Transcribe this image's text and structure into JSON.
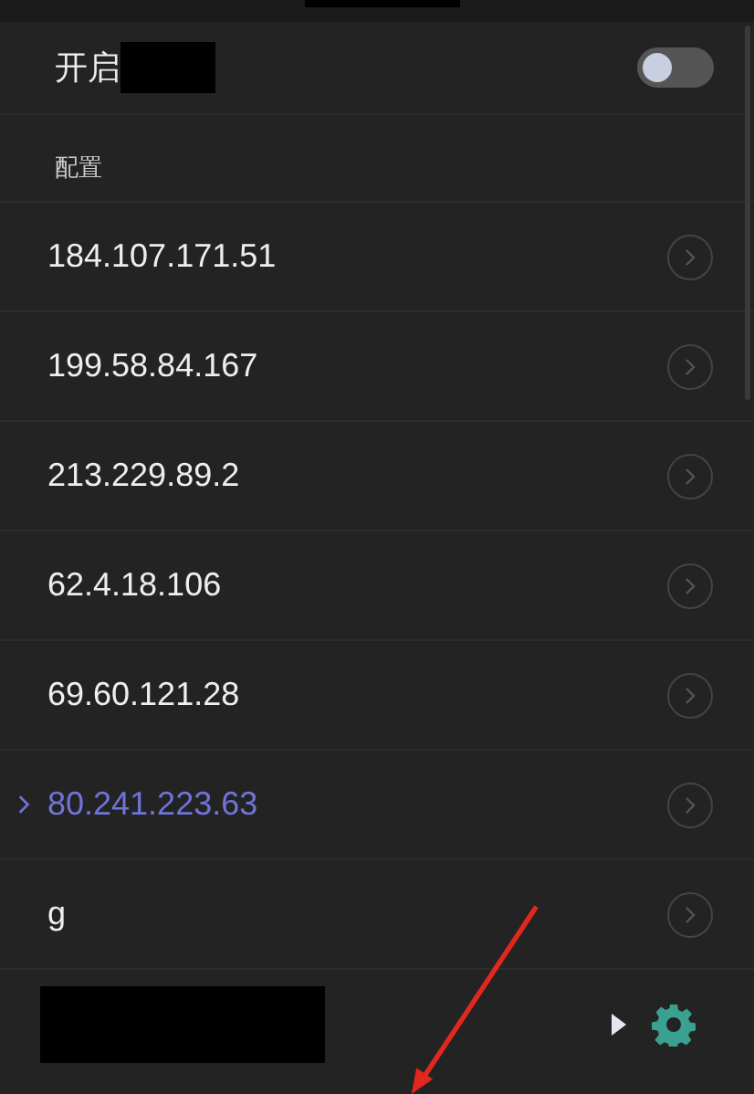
{
  "header": {
    "label": "开启",
    "toggle": {
      "on": false
    }
  },
  "section_title": "配置",
  "servers": [
    {
      "name": "184.107.171.51",
      "selected": false
    },
    {
      "name": "199.58.84.167",
      "selected": false
    },
    {
      "name": "213.229.89.2",
      "selected": false
    },
    {
      "name": "62.4.18.106",
      "selected": false
    },
    {
      "name": "69.60.121.28",
      "selected": false
    },
    {
      "name": "80.241.223.63",
      "selected": true
    },
    {
      "name": "g",
      "selected": false
    }
  ]
}
